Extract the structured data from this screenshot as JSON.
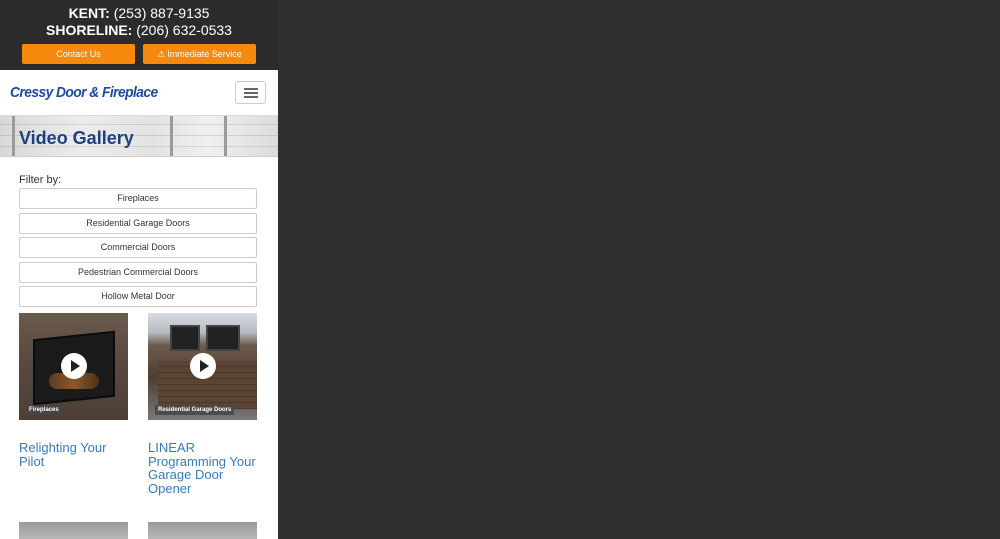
{
  "topbar": {
    "kent_label": "KENT:",
    "kent_phone": "(253) 887-9135",
    "shoreline_label": "SHORELINE:",
    "shoreline_phone": "(206) 632-0533",
    "contact_button": "Contact Us",
    "service_button": "Immediate Service",
    "service_icon": "warning-icon"
  },
  "colors": {
    "cta": "#f7890e",
    "brand": "#1d4aa0",
    "link": "#3a7ab8",
    "topbar": "#2b2b2b",
    "backdrop": "#2f2f2f"
  },
  "navbar": {
    "logo_text": "Cressy Door & Fireplace",
    "menu_icon": "hamburger-icon"
  },
  "banner": {
    "title": "Video Gallery"
  },
  "filter": {
    "label": "Filter by:",
    "options": [
      "Fireplaces",
      "Residential Garage Doors",
      "Commercial Doors",
      "Pedestrian Commercial Doors",
      "Hollow Metal Door"
    ]
  },
  "videos": [
    {
      "category": "Fireplaces",
      "title": "Relighting Your Pilot"
    },
    {
      "category": "Residential Garage Doors",
      "title": "LINEAR Programming Your Garage Door Opener"
    }
  ]
}
